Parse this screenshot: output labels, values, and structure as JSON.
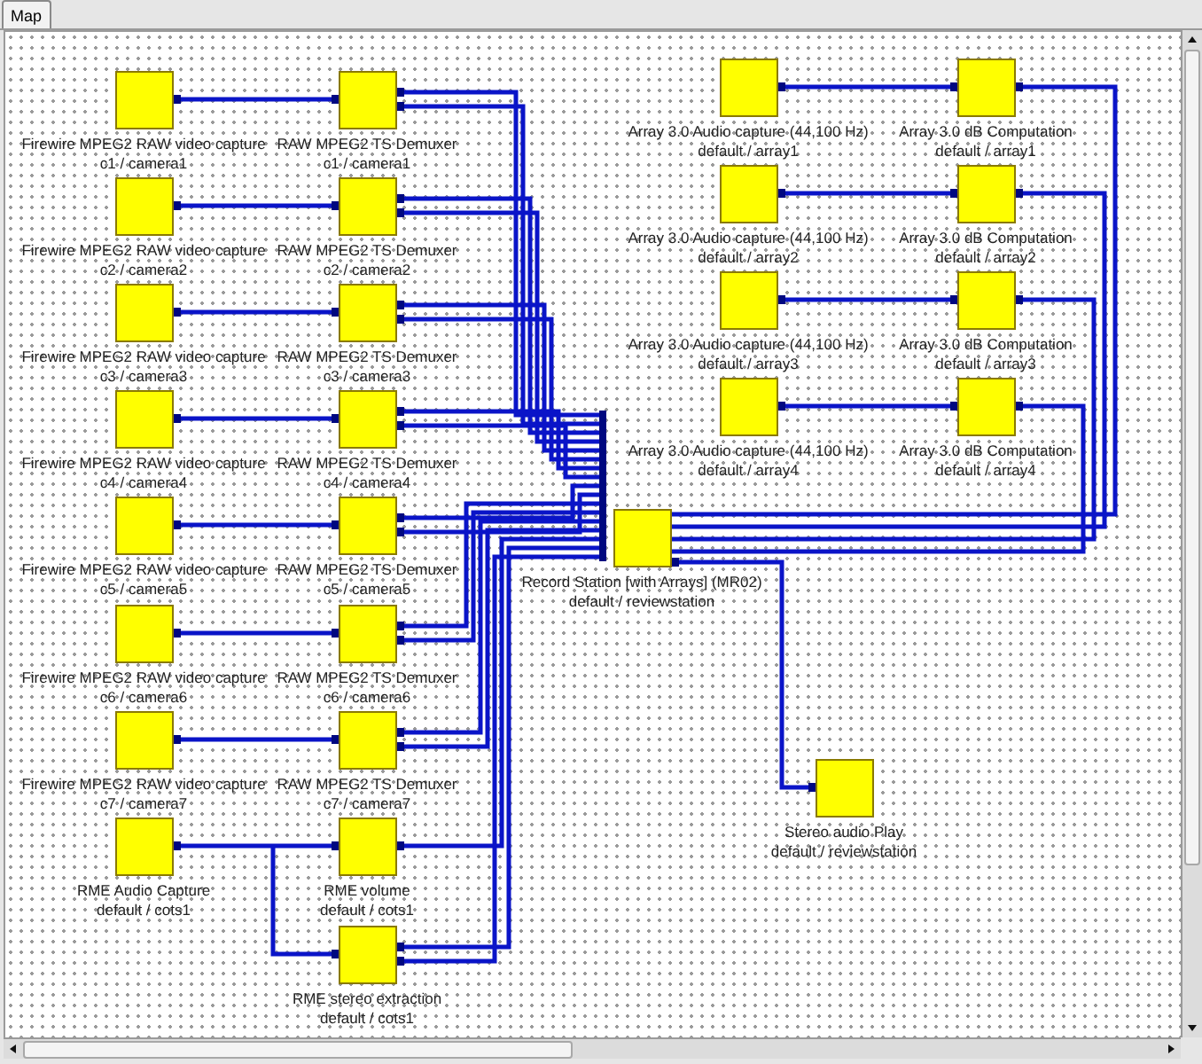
{
  "tabs": [
    {
      "label": "Map",
      "selected": true
    }
  ],
  "map": {
    "camera_chains": [
      {
        "capture": {
          "title": "Firewire MPEG2 RAW video capture",
          "instance": "c1 / camera1"
        },
        "demuxer": {
          "title": "RAW MPEG2 TS Demuxer",
          "instance": "c1 / camera1"
        }
      },
      {
        "capture": {
          "title": "Firewire MPEG2 RAW video capture",
          "instance": "c2 / camera2"
        },
        "demuxer": {
          "title": "RAW MPEG2 TS Demuxer",
          "instance": "c2 / camera2"
        }
      },
      {
        "capture": {
          "title": "Firewire MPEG2 RAW video capture",
          "instance": "c3 / camera3"
        },
        "demuxer": {
          "title": "RAW MPEG2 TS Demuxer",
          "instance": "c3 / camera3"
        }
      },
      {
        "capture": {
          "title": "Firewire MPEG2 RAW video capture",
          "instance": "c4 / camera4"
        },
        "demuxer": {
          "title": "RAW MPEG2 TS Demuxer",
          "instance": "c4 / camera4"
        }
      },
      {
        "capture": {
          "title": "Firewire MPEG2 RAW video capture",
          "instance": "c5 / camera5"
        },
        "demuxer": {
          "title": "RAW MPEG2 TS Demuxer",
          "instance": "c5 / camera5"
        }
      },
      {
        "capture": {
          "title": "Firewire MPEG2 RAW video capture",
          "instance": "c6 / camera6"
        },
        "demuxer": {
          "title": "RAW MPEG2 TS Demuxer",
          "instance": "c6 / camera6"
        }
      },
      {
        "capture": {
          "title": "Firewire MPEG2 RAW video capture",
          "instance": "c7 / camera7"
        },
        "demuxer": {
          "title": "RAW MPEG2 TS Demuxer",
          "instance": "c7 / camera7"
        }
      }
    ],
    "rme": {
      "capture": {
        "title": "RME Audio Capture",
        "instance": "default / cots1"
      },
      "volume": {
        "title": "RME volume",
        "instance": "default / cots1"
      },
      "extraction": {
        "title": "RME stereo extraction",
        "instance": "default / cots1"
      }
    },
    "array_chains": [
      {
        "capture": {
          "title": "Array 3.0 Audio capture (44,100 Hz)",
          "instance": "default / array1"
        },
        "computation": {
          "title": "Array 3.0 dB Computation",
          "instance": "default / array1"
        }
      },
      {
        "capture": {
          "title": "Array 3.0 Audio capture (44,100 Hz)",
          "instance": "default / array2"
        },
        "computation": {
          "title": "Array 3.0 dB Computation",
          "instance": "default / array2"
        }
      },
      {
        "capture": {
          "title": "Array 3.0 Audio capture (44,100 Hz)",
          "instance": "default / array3"
        },
        "computation": {
          "title": "Array 3.0 dB Computation",
          "instance": "default / array3"
        }
      },
      {
        "capture": {
          "title": "Array 3.0 Audio capture (44,100 Hz)",
          "instance": "default / array4"
        },
        "computation": {
          "title": "Array 3.0 dB Computation",
          "instance": "default / array4"
        }
      }
    ],
    "recorder": {
      "title": "Record Station [with Arrays] (MR02)",
      "instance": "default / reviewstation"
    },
    "player": {
      "title": "Stereo audio Play",
      "instance": "default / reviewstation"
    }
  }
}
